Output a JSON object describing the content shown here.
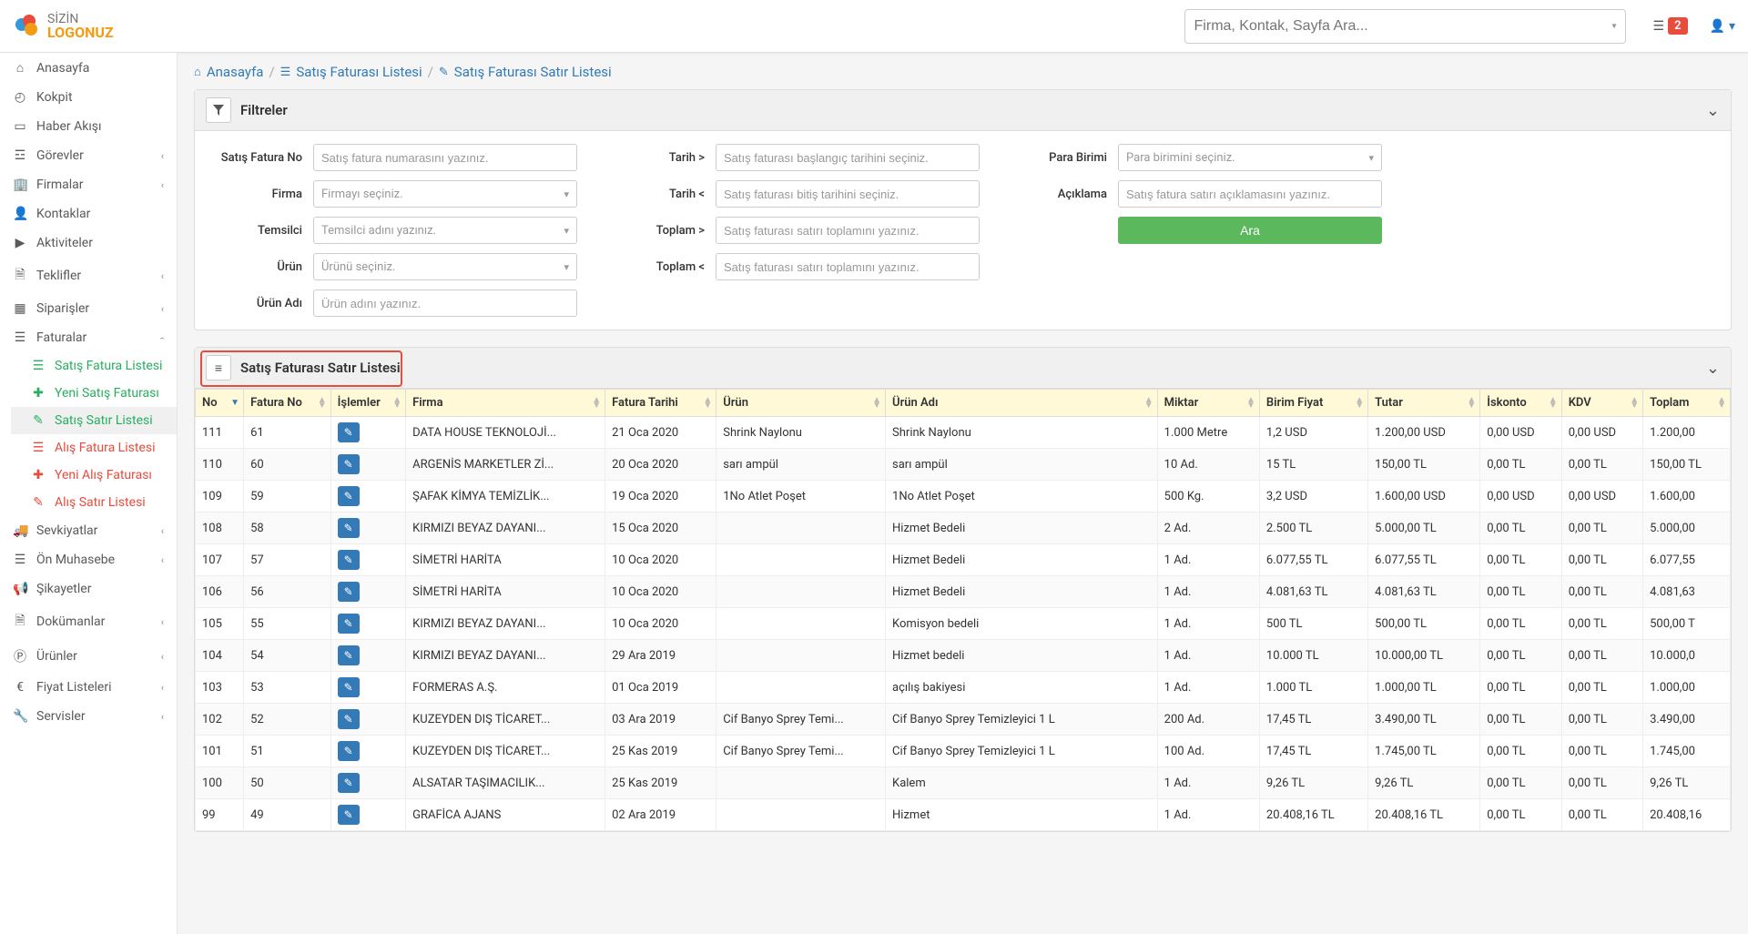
{
  "logo": {
    "line1": "SİZİN",
    "line2": "LOGONUZ"
  },
  "topbar": {
    "search_placeholder": "Firma, Kontak, Sayfa Ara...",
    "notif_count": "2"
  },
  "sidebar": [
    {
      "label": "Anasayfa",
      "icon": "home",
      "chev": false
    },
    {
      "label": "Kokpit",
      "icon": "dashboard",
      "chev": false
    },
    {
      "label": "Haber Akışı",
      "icon": "news",
      "chev": false
    },
    {
      "label": "Görevler",
      "icon": "tasks",
      "chev": true
    },
    {
      "label": "Firmalar",
      "icon": "building",
      "chev": true
    },
    {
      "label": "Kontaklar",
      "icon": "user",
      "chev": false
    },
    {
      "label": "Aktiviteler",
      "icon": "video",
      "chev": false
    },
    {
      "label": "Teklifler",
      "icon": "file",
      "chev": true
    },
    {
      "label": "Siparişler",
      "icon": "calendar",
      "chev": true
    },
    {
      "label": "Faturalar",
      "icon": "list",
      "chev": true,
      "open": true,
      "children": [
        {
          "label": "Satış Fatura Listesi",
          "icon": "list",
          "cls": "green"
        },
        {
          "label": "Yeni Satış Faturası",
          "icon": "plus",
          "cls": "green"
        },
        {
          "label": "Satış Satır Listesi",
          "icon": "pencil",
          "cls": "green",
          "active": true
        },
        {
          "label": "Alış Fatura Listesi",
          "icon": "list",
          "cls": "red"
        },
        {
          "label": "Yeni Alış Faturası",
          "icon": "plus",
          "cls": "red"
        },
        {
          "label": "Alış Satır Listesi",
          "icon": "pencil",
          "cls": "red"
        }
      ]
    },
    {
      "label": "Sevkiyatlar",
      "icon": "truck",
      "chev": true
    },
    {
      "label": "Ön Muhasebe",
      "icon": "list",
      "chev": true
    },
    {
      "label": "Şikayetler",
      "icon": "bullhorn",
      "chev": false
    },
    {
      "label": "Dokümanlar",
      "icon": "file",
      "chev": true
    },
    {
      "label": "Ürünler",
      "icon": "product",
      "chev": true
    },
    {
      "label": "Fiyat Listeleri",
      "icon": "euro",
      "chev": true
    },
    {
      "label": "Servisler",
      "icon": "wrench",
      "chev": true
    }
  ],
  "breadcrumb": {
    "home": "Anasayfa",
    "l1": "Satış Faturası Listesi",
    "l2": "Satış Faturası Satır Listesi"
  },
  "filters": {
    "panel_title": "Filtreler",
    "labels": {
      "no": "Satış Fatura No",
      "firma": "Firma",
      "temsilci": "Temsilci",
      "urun": "Ürün",
      "urunadi": "Ürün Adı",
      "tarih_gt": "Tarih >",
      "tarih_lt": "Tarih <",
      "toplam_gt": "Toplam >",
      "toplam_lt": "Toplam <",
      "para": "Para Birimi",
      "aciklama": "Açıklama"
    },
    "placeholders": {
      "no": "Satış fatura numarasını yazınız.",
      "firma": "Firmayı seçiniz.",
      "temsilci": "Temsilci adını yazınız.",
      "urun": "Ürünü seçiniz.",
      "urunadi": "Ürün adını yazınız.",
      "tarih_gt": "Satış faturası başlangıç tarihini seçiniz.",
      "tarih_lt": "Satış faturası bitiş tarihini seçiniz.",
      "toplam_gt": "Satış faturası satırı toplamını yazınız.",
      "toplam_lt": "Satış faturası satırı toplamını yazınız.",
      "para": "Para birimini seçiniz.",
      "aciklama": "Satış fatura satırı açıklamasını yazınız."
    },
    "search_btn": "Ara"
  },
  "listPanel": {
    "title": "Satış Faturası Satır Listesi"
  },
  "table": {
    "headers": [
      "No",
      "Fatura No",
      "İşlemler",
      "Firma",
      "Fatura Tarihi",
      "Ürün",
      "Ürün Adı",
      "Miktar",
      "Birim Fiyat",
      "Tutar",
      "İskonto",
      "KDV",
      "Toplam"
    ],
    "rows": [
      [
        "111",
        "61",
        "",
        "DATA HOUSE TEKNOLOJİ...",
        "21 Oca 2020",
        "Shrink Naylonu",
        "Shrink Naylonu",
        "1.000 Metre",
        "1,2 USD",
        "1.200,00 USD",
        "0,00 USD",
        "0,00 USD",
        "1.200,00"
      ],
      [
        "110",
        "60",
        "",
        "ARGENİS MARKETLER Zİ...",
        "20 Oca 2020",
        "sarı ampül",
        "sarı ampül",
        "10 Ad.",
        "15 TL",
        "150,00 TL",
        "0,00 TL",
        "0,00 TL",
        "150,00 TL"
      ],
      [
        "109",
        "59",
        "",
        "ŞAFAK KİMYA TEMİZLİK...",
        "19 Oca 2020",
        "1No Atlet Poşet",
        "1No Atlet Poşet",
        "500 Kg.",
        "3,2 USD",
        "1.600,00 USD",
        "0,00 USD",
        "0,00 USD",
        "1.600,00"
      ],
      [
        "108",
        "58",
        "",
        "KIRMIZI BEYAZ DAYANI...",
        "15 Oca 2020",
        "",
        "Hizmet Bedeli",
        "2 Ad.",
        "2.500 TL",
        "5.000,00 TL",
        "0,00 TL",
        "0,00 TL",
        "5.000,00"
      ],
      [
        "107",
        "57",
        "",
        "SİMETRİ HARİTA",
        "10 Oca 2020",
        "",
        "Hizmet Bedeli",
        "1 Ad.",
        "6.077,55 TL",
        "6.077,55 TL",
        "0,00 TL",
        "0,00 TL",
        "6.077,55"
      ],
      [
        "106",
        "56",
        "",
        "SİMETRİ HARİTA",
        "10 Oca 2020",
        "",
        "Hizmet Bedeli",
        "1 Ad.",
        "4.081,63 TL",
        "4.081,63 TL",
        "0,00 TL",
        "0,00 TL",
        "4.081,63"
      ],
      [
        "105",
        "55",
        "",
        "KIRMIZI BEYAZ DAYANI...",
        "10 Oca 2020",
        "",
        "Komisyon bedeli",
        "1 Ad.",
        "500 TL",
        "500,00 TL",
        "0,00 TL",
        "0,00 TL",
        "500,00 T"
      ],
      [
        "104",
        "54",
        "",
        "KIRMIZI BEYAZ DAYANI...",
        "29 Ara 2019",
        "",
        "Hizmet bedeli",
        "1 Ad.",
        "10.000 TL",
        "10.000,00 TL",
        "0,00 TL",
        "0,00 TL",
        "10.000,0"
      ],
      [
        "103",
        "53",
        "",
        "FORMERAS A.Ş.",
        "01 Oca 2019",
        "",
        "açılış bakiyesi",
        "1 Ad.",
        "1.000 TL",
        "1.000,00 TL",
        "0,00 TL",
        "0,00 TL",
        "1.000,00"
      ],
      [
        "102",
        "52",
        "",
        "KUZEYDEN DIŞ TİCARET...",
        "03 Ara 2019",
        "Cif Banyo Sprey Temi...",
        "Cif Banyo Sprey Temizleyici 1 L",
        "200 Ad.",
        "17,45 TL",
        "3.490,00 TL",
        "0,00 TL",
        "0,00 TL",
        "3.490,00"
      ],
      [
        "101",
        "51",
        "",
        "KUZEYDEN DIŞ TİCARET...",
        "25 Kas 2019",
        "Cif Banyo Sprey Temi...",
        "Cif Banyo Sprey Temizleyici 1 L",
        "100 Ad.",
        "17,45 TL",
        "1.745,00 TL",
        "0,00 TL",
        "0,00 TL",
        "1.745,00"
      ],
      [
        "100",
        "50",
        "",
        "ALSATAR TAŞIMACILIK...",
        "25 Kas 2019",
        "",
        "Kalem",
        "1 Ad.",
        "9,26 TL",
        "9,26 TL",
        "0,00 TL",
        "0,00 TL",
        "9,26 TL"
      ],
      [
        "99",
        "49",
        "",
        "GRAFİCA AJANS",
        "02 Ara 2019",
        "",
        "Hizmet",
        "1 Ad.",
        "20.408,16 TL",
        "20.408,16 TL",
        "0,00 TL",
        "0,00 TL",
        "20.408,16"
      ]
    ]
  },
  "icons": {
    "home": "⌂",
    "dashboard": "🏁",
    "news": "▭",
    "tasks": "☰",
    "building": "🏢",
    "user": "👤",
    "video": "▶",
    "file": "📄",
    "calendar": "▦",
    "list": "☰",
    "plus": "✚",
    "pencil": "✎",
    "truck": "🚚",
    "bullhorn": "📢",
    "product": "Ⓟ",
    "euro": "€",
    "wrench": "🔧",
    "filter": "▼",
    "menu": "≡",
    "chev": "›",
    "chevdown": "⌄",
    "edit": "✎"
  }
}
